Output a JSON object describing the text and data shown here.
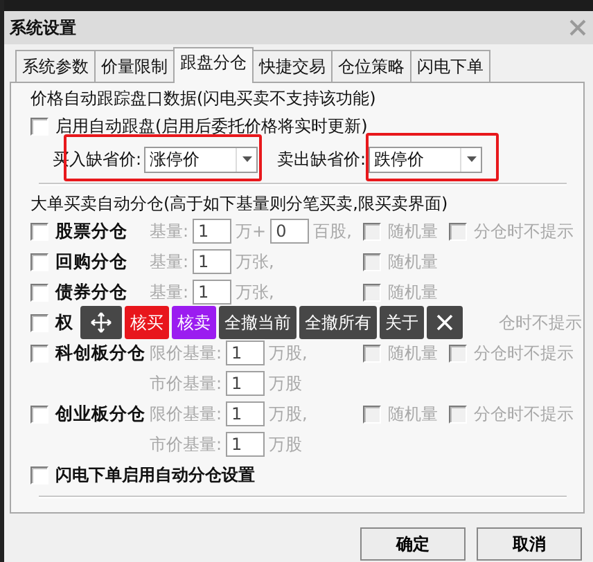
{
  "window": {
    "title": "系统设置"
  },
  "tabs": [
    {
      "label": "系统参数",
      "selected": false
    },
    {
      "label": "价量限制",
      "selected": false
    },
    {
      "label": "跟盘分仓",
      "selected": true
    },
    {
      "label": "快捷交易",
      "selected": false
    },
    {
      "label": "仓位策略",
      "selected": false
    },
    {
      "label": "闪电下单",
      "selected": false
    }
  ],
  "tracking": {
    "title": "价格自动跟踪盘口数据(闪电买卖不支持该功能)",
    "auto_track": {
      "label": "启用自动跟盘(启用后委托价格将实时更新)",
      "checked": false
    },
    "defaults": [
      {
        "label": "买入缺省价:",
        "value": "涨停价",
        "highlighted": true
      },
      {
        "label": "卖出缺省价:",
        "value": "跌停价",
        "highlighted": true
      }
    ]
  },
  "splitting": {
    "title": "大单买卖自动分仓(高于如下基量则分笔买卖,限买卖界面)",
    "rows": [
      {
        "label": "股票分仓",
        "checked": false,
        "disabled": true,
        "fields": [
          {
            "kind": "text",
            "text": "基量:"
          },
          {
            "kind": "input",
            "value": "1"
          },
          {
            "kind": "text",
            "text": "万+"
          },
          {
            "kind": "input",
            "value": "0"
          },
          {
            "kind": "text",
            "text": "百股,"
          }
        ],
        "random": {
          "label": "随机量",
          "checked": false
        },
        "no_prompt": {
          "label": "分仓时不提示",
          "checked": false
        }
      },
      {
        "label": "回购分仓",
        "checked": false,
        "disabled": true,
        "fields": [
          {
            "kind": "text",
            "text": "基量:"
          },
          {
            "kind": "input",
            "value": "1"
          },
          {
            "kind": "text",
            "text": "万张,"
          }
        ],
        "random": {
          "label": "随机量",
          "checked": false
        }
      },
      {
        "label": "债券分仓",
        "checked": false,
        "disabled": true,
        "fields": [
          {
            "kind": "text",
            "text": "基量:"
          },
          {
            "kind": "input",
            "value": "1"
          },
          {
            "kind": "text",
            "text": "万张,"
          }
        ],
        "random": {
          "label": "随机量",
          "checked": false
        }
      },
      {
        "label": "权",
        "checked": false,
        "disabled": true,
        "fields": [],
        "no_prompt": {
          "label": "仓时不提示"
        }
      },
      {
        "label": "科创板分仓",
        "checked": false,
        "disabled": true,
        "fields": [
          {
            "kind": "text",
            "text": "限价基量:"
          },
          {
            "kind": "input",
            "value": "1"
          },
          {
            "kind": "text",
            "text": "万股,"
          }
        ],
        "random": {
          "label": "随机量",
          "checked": false
        },
        "no_prompt": {
          "label": "分仓时不提示",
          "checked": false
        }
      },
      {
        "disabled": true,
        "fields": [
          {
            "kind": "text",
            "text": "市价基量:"
          },
          {
            "kind": "input",
            "value": "1"
          },
          {
            "kind": "text",
            "text": "万股"
          }
        ]
      },
      {
        "label": "创业板分仓",
        "checked": false,
        "disabled": true,
        "fields": [
          {
            "kind": "text",
            "text": "限价基量:"
          },
          {
            "kind": "input",
            "value": "1"
          },
          {
            "kind": "text",
            "text": "万股,"
          }
        ],
        "random": {
          "label": "随机量",
          "checked": false
        },
        "no_prompt": {
          "label": "分仓时不提示",
          "checked": false
        }
      },
      {
        "disabled": true,
        "fields": [
          {
            "kind": "text",
            "text": "市价基量:"
          },
          {
            "kind": "input",
            "value": "1"
          },
          {
            "kind": "text",
            "text": "万股"
          }
        ]
      }
    ],
    "flash_split": {
      "label": "闪电下单启用自动分仓设置",
      "checked": false
    }
  },
  "toolbar": [
    {
      "kind": "move"
    },
    {
      "kind": "button",
      "label": "核买",
      "color": "#e8161c"
    },
    {
      "kind": "button",
      "label": "核卖",
      "color": "#9b1cf0"
    },
    {
      "kind": "button",
      "label": "全撤当前",
      "color": "#474747"
    },
    {
      "kind": "button",
      "label": "全撤所有",
      "color": "#474747"
    },
    {
      "kind": "button",
      "label": "关于",
      "color": "#474747"
    },
    {
      "kind": "close"
    }
  ],
  "buttons": [
    "确定",
    "取消"
  ]
}
